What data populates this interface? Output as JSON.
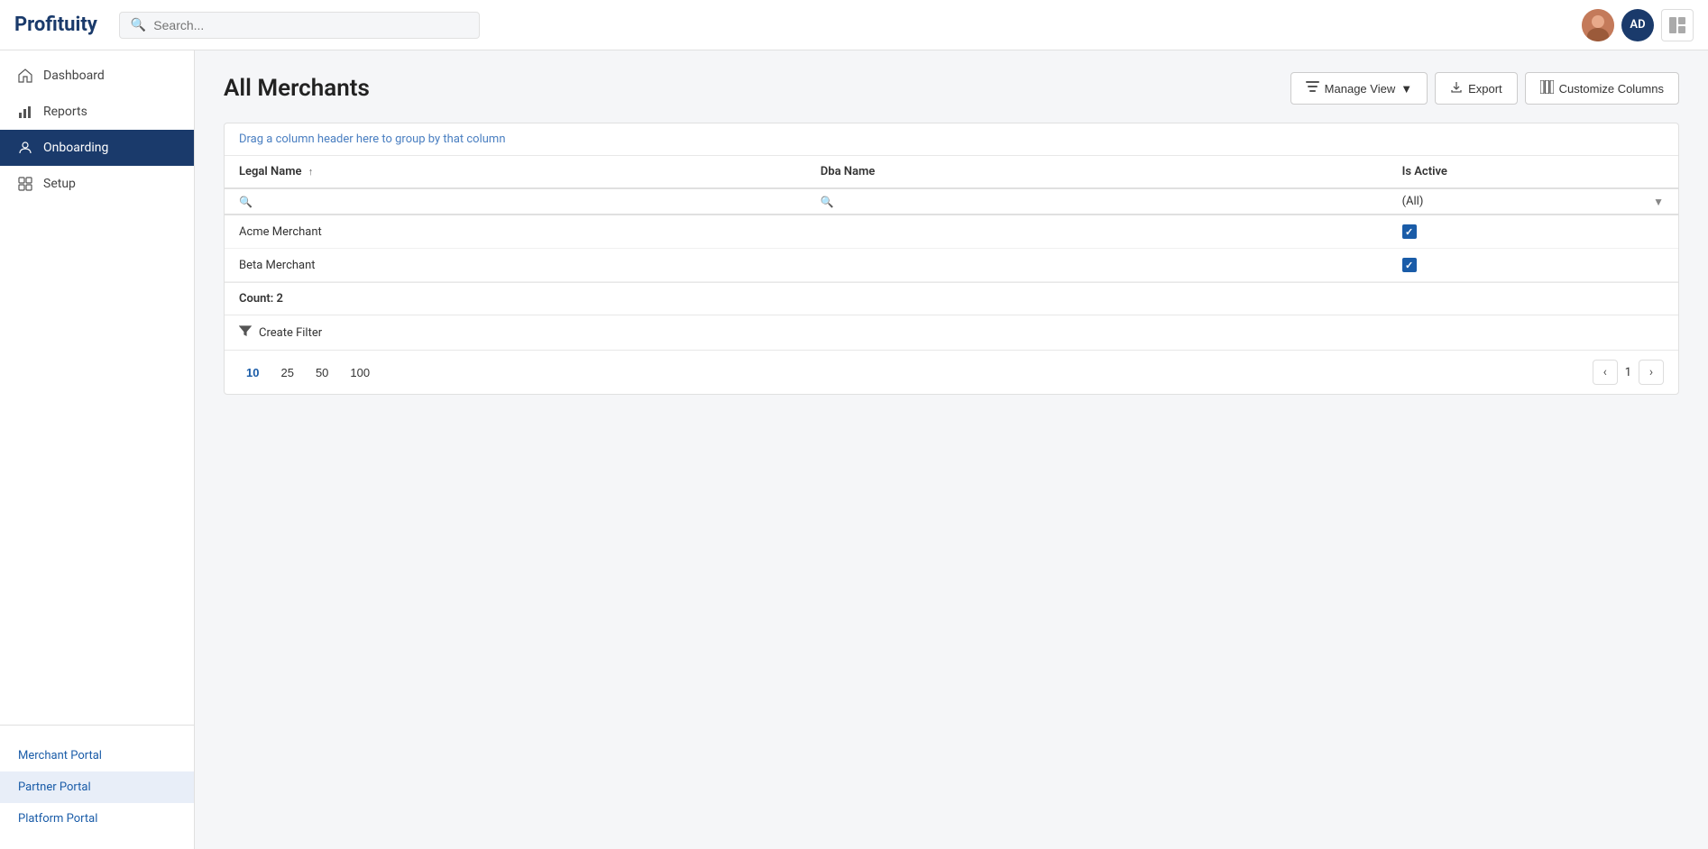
{
  "app": {
    "logo": "Profituity",
    "user_initials": "AD"
  },
  "header": {
    "search_placeholder": "Search..."
  },
  "sidebar": {
    "items": [
      {
        "id": "dashboard",
        "label": "Dashboard",
        "icon": "home"
      },
      {
        "id": "reports",
        "label": "Reports",
        "icon": "bar-chart"
      },
      {
        "id": "onboarding",
        "label": "Onboarding",
        "icon": "user",
        "active": true
      }
    ],
    "setup": {
      "label": "Setup",
      "icon": "grid"
    },
    "bottom_links": [
      {
        "id": "merchant-portal",
        "label": "Merchant Portal",
        "selected": false
      },
      {
        "id": "partner-portal",
        "label": "Partner Portal",
        "selected": true
      },
      {
        "id": "platform-portal",
        "label": "Platform Portal",
        "selected": false
      }
    ]
  },
  "main": {
    "page_title": "All Merchants",
    "drag_hint": "Drag a column header here to group by that column",
    "toolbar": {
      "manage_view": "Manage View",
      "export": "Export",
      "customize_columns": "Customize Columns"
    },
    "table": {
      "columns": [
        {
          "id": "legal_name",
          "label": "Legal Name",
          "sortable": true,
          "sort_dir": "asc"
        },
        {
          "id": "dba_name",
          "label": "Dba Name",
          "sortable": false
        },
        {
          "id": "is_active",
          "label": "Is Active",
          "sortable": false
        }
      ],
      "filter_all_label": "(All)",
      "rows": [
        {
          "legal_name": "Acme Merchant",
          "dba_name": "",
          "is_active": true
        },
        {
          "legal_name": "Beta Merchant",
          "dba_name": "",
          "is_active": true
        }
      ],
      "count_label": "Count: 2",
      "create_filter_label": "Create Filter"
    },
    "pagination": {
      "page_sizes": [
        "10",
        "25",
        "50",
        "100"
      ],
      "active_page_size": "10",
      "current_page": "1",
      "prev_disabled": true,
      "next_disabled": false
    }
  }
}
